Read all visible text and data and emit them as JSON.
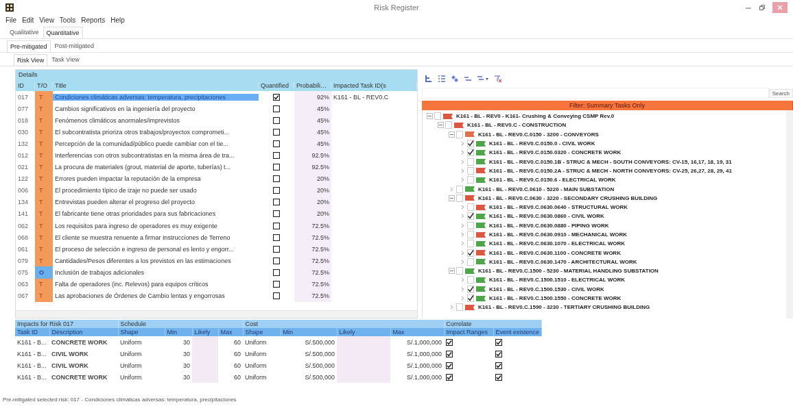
{
  "window": {
    "title": "Risk Register"
  },
  "menu": [
    "File",
    "Edit",
    "View",
    "Tools",
    "Reports",
    "Help"
  ],
  "tabs_analysis": [
    {
      "label": "Qualitative",
      "selected": false
    },
    {
      "label": "Quantitative",
      "selected": true
    }
  ],
  "tabs_mitigation": [
    {
      "label": "Pre-mitigated",
      "selected": true
    },
    {
      "label": "Post-mitigated",
      "selected": false
    }
  ],
  "tabs_view": [
    {
      "label": "Risk View",
      "selected": true
    },
    {
      "label": "Task View",
      "selected": false
    }
  ],
  "details": {
    "title": "Details",
    "columns": [
      "ID",
      "T/O",
      "Title",
      "Quantified",
      "Probabili…",
      "Impacted Task ID(s"
    ],
    "rows": [
      {
        "id": "017",
        "kind": "threat",
        "t_o": "T",
        "title": "Condiciones climáticas adversas: temperatura, precipitaciones",
        "quantified": true,
        "probability": "92%",
        "impacted": "K161 - BL - REV0.C",
        "selected": true
      },
      {
        "id": "077",
        "kind": "threat",
        "t_o": "T",
        "title": "Cambios significativos en la ingeniería del proyecto",
        "quantified": false,
        "probability": "45%",
        "selected": false
      },
      {
        "id": "018",
        "kind": "threat",
        "t_o": "T",
        "title": "Fenómenos climáticos anormales/imprevistos",
        "quantified": false,
        "probability": "45%",
        "selected": false
      },
      {
        "id": "030",
        "kind": "threat",
        "t_o": "T",
        "title": "El subcontratista prioriza otros trabajos/proyectos comprometi...",
        "quantified": false,
        "probability": "45%",
        "selected": false
      },
      {
        "id": "132",
        "kind": "threat",
        "t_o": "T",
        "title": "Percepción de la comunidad/público puede cambiar con el tie...",
        "quantified": false,
        "probability": "45%",
        "selected": false
      },
      {
        "id": "012",
        "kind": "threat",
        "t_o": "T",
        "title": "Interferencias con otros subcontratistas en la misma área de tra...",
        "quantified": false,
        "probability": "92.5%",
        "selected": false
      },
      {
        "id": "021",
        "kind": "threat",
        "t_o": "T",
        "title": "La procura de materiales (grout, material de aporte, tuberías) t...",
        "quantified": false,
        "probability": "92.5%",
        "selected": false
      },
      {
        "id": "122",
        "kind": "threat",
        "t_o": "T",
        "title": "Errores pueden impactar la reputación de la empresa",
        "quantified": false,
        "probability": "20%",
        "selected": false
      },
      {
        "id": "006",
        "kind": "threat",
        "t_o": "T",
        "title": "El procedimiento típico de izaje no puede ser usado",
        "quantified": false,
        "probability": "20%",
        "selected": false
      },
      {
        "id": "134",
        "kind": "threat",
        "t_o": "T",
        "title": "Entrevistas pueden alterar el progreso del proyecto",
        "quantified": false,
        "probability": "20%",
        "selected": false
      },
      {
        "id": "141",
        "kind": "threat",
        "t_o": "T",
        "title": "El fabricante tiene otras prioridades para sus fabricaciones",
        "quantified": false,
        "probability": "20%",
        "selected": false
      },
      {
        "id": "062",
        "kind": "threat",
        "t_o": "T",
        "title": "Los requisitos para ingreso de operadores es muy exigente",
        "quantified": false,
        "probability": "72.5%",
        "selected": false
      },
      {
        "id": "068",
        "kind": "threat",
        "t_o": "T",
        "title": "El cliente se muestra renuente a firmar Instrucciones de Terreno",
        "quantified": false,
        "probability": "72.5%",
        "selected": false
      },
      {
        "id": "061",
        "kind": "threat",
        "t_o": "T",
        "title": "El proceso de selección e ingreso de personal es lento y engorr...",
        "quantified": false,
        "probability": "72.5%",
        "selected": false
      },
      {
        "id": "079",
        "kind": "threat",
        "t_o": "T",
        "title": "Cantidades/Pesos diferentes a los previstos en las estimaciones",
        "quantified": false,
        "probability": "72.5%",
        "selected": false
      },
      {
        "id": "075",
        "kind": "opportunity",
        "t_o": "O",
        "title": "Inclusión de trabajos adicionales",
        "quantified": false,
        "probability": "72.5%",
        "selected": false
      },
      {
        "id": "063",
        "kind": "threat",
        "t_o": "T",
        "title": "Falta de operadores (inc. Relevos) para equipos críticos",
        "quantified": false,
        "probability": "72.5%",
        "selected": false
      },
      {
        "id": "067",
        "kind": "threat",
        "t_o": "T",
        "title": "Las aprobaciones de Órdenes de Cambio lentas y engorrosas",
        "quantified": false,
        "probability": "72.5%",
        "selected": false
      }
    ]
  },
  "task_panel": {
    "search_button": "Search",
    "filter_banner": "Filter: Summary Tasks Only",
    "tree": [
      {
        "label": "K161 - BL - REV0 - K161- Crushing & Conveying CSMP Rev.0",
        "color": "#d9583f",
        "checked": false,
        "children": [
          {
            "label": "K161 - BL - REV0.C - CONSTRUCTION",
            "color": "#d9583f",
            "checked": false,
            "children": [
              {
                "label": "K161 - BL - REV0.C.0150 - 3200 - CONVEYORS",
                "color": "#e0704a",
                "checked": false,
                "children": [
                  {
                    "label": "K161 - BL - REV0.C.0150.0 - CIVIL WORK",
                    "color": "#4fa64a",
                    "checked": true
                  },
                  {
                    "label": "K161 - BL - REV0.C.0150.0320 - CONCRETE WORK",
                    "color": "#4fa64a",
                    "checked": true
                  },
                  {
                    "label": "K161 - BL - REV0.C.0150.1B - STRUC & MECH - SOUTH CONVEYORS: CV-15, 16,17, 18, 19, 31",
                    "color": "#4fa64a",
                    "checked": false
                  },
                  {
                    "label": "K161 - BL - REV0.C.0150.2A - STRUC & MECH - NORTH CONVEYORS: CV-25, 26,27, 28, 29, 41",
                    "color": "#d9583f",
                    "checked": false
                  },
                  {
                    "label": "K161 - BL - REV0.C.0150.6 - ELECTRICAL WORK",
                    "color": "#4fa64a",
                    "checked": false
                  }
                ]
              },
              {
                "label": "K161 - BL - REV0.C.0610 - 5220 - MAIN SUBSTATION",
                "color": "#4fa64a",
                "checked": false
              },
              {
                "label": "K161 - BL - REV0.C.0630 - 3220 - SECONDARY CRUSHING BUILDING",
                "color": "#d9583f",
                "checked": false,
                "children": [
                  {
                    "label": "K161 - BL - REV0.C.0630.0640 - STRUCTURAL WORK",
                    "color": "#d9583f",
                    "checked": false
                  },
                  {
                    "label": "K161 - BL - REV0.C.0630.0860 - CIVIL WORK",
                    "color": "#4fa64a",
                    "checked": true
                  },
                  {
                    "label": "K161 - BL - REV0.C.0630.0880 - PIPING WORK",
                    "color": "#4fa64a",
                    "checked": false
                  },
                  {
                    "label": "K161 - BL - REV0.C.0630.0910 - MECHANICAL WORK",
                    "color": "#d9583f",
                    "checked": false
                  },
                  {
                    "label": "K161 - BL - REV0.C.0630.1070 - ELECTRICAL WORK",
                    "color": "#4fa64a",
                    "checked": false
                  },
                  {
                    "label": "K161 - BL - REV0.C.0630.1100 - CONCRETE WORK",
                    "color": "#d9583f",
                    "checked": true
                  },
                  {
                    "label": "K161 - BL - REV0.C.0630.1470 - ARCHITECTURAL WORK",
                    "color": "#4fa64a",
                    "checked": false
                  }
                ]
              },
              {
                "label": "K161 - BL - REV0.C.1500 - 5230 - MATERIAL HANDLING SUBSTATION",
                "color": "#4fa64a",
                "checked": false,
                "children": [
                  {
                    "label": "K161 - BL - REV0.C.1500.1510 - ELECTRICAL WORK",
                    "color": "#4fa64a",
                    "checked": false
                  },
                  {
                    "label": "K161 - BL - REV0.C.1500.1530 - CIVIL WORK",
                    "color": "#4fa64a",
                    "checked": true
                  },
                  {
                    "label": "K161 - BL - REV0.C.1500.1550 - CONCRETE WORK",
                    "color": "#4fa64a",
                    "checked": true
                  }
                ]
              },
              {
                "label": "K161 - BL - REV0.C.1590 - 3230 - TERTIARY CRUSHING BUILDING",
                "color": "#d9583f",
                "checked": false
              }
            ]
          }
        ]
      }
    ]
  },
  "impacts": {
    "groups": [
      "Impacts for Risk 017",
      "Schedule",
      "Cost",
      "Correlate"
    ],
    "columns": [
      "Task ID",
      "Description",
      "Shape",
      "Min",
      "Likely",
      "Max",
      "Shape",
      "Min",
      "Likely",
      "Max",
      "Impact Ranges",
      "Event existence"
    ],
    "rows": [
      {
        "task_id": "K161 - B...",
        "description": "CONCRETE WORK",
        "s_shape": "Uniform",
        "s_min": "30",
        "s_max": "60",
        "c_shape": "Uniform",
        "c_min": "S/.500,000",
        "c_max": "S/.1,000,000",
        "impact_ranges": true,
        "event_existence": true
      },
      {
        "task_id": "K161 - B...",
        "description": "CIVIL WORK",
        "s_shape": "Uniform",
        "s_min": "30",
        "s_max": "60",
        "c_shape": "Uniform",
        "c_min": "S/.500,000",
        "c_max": "S/.1,000,000",
        "impact_ranges": true,
        "event_existence": true
      },
      {
        "task_id": "K161 - B...",
        "description": "CIVIL WORK",
        "s_shape": "Uniform",
        "s_min": "30",
        "s_max": "60",
        "c_shape": "Uniform",
        "c_min": "S/.500,000",
        "c_max": "S/.1,000,000",
        "impact_ranges": true,
        "event_existence": true
      },
      {
        "task_id": "K161 - B...",
        "description": "CONCRETE WORK",
        "s_shape": "Uniform",
        "s_min": "30",
        "s_max": "60",
        "c_shape": "Uniform",
        "c_min": "S/.500,000",
        "c_max": "S/.1,000,000",
        "impact_ranges": true,
        "event_existence": true
      }
    ]
  },
  "status_bar": "Pre-mitigated selected risk: 017 - Condiciones climáticas adversas: temperatura, precipitaciones"
}
